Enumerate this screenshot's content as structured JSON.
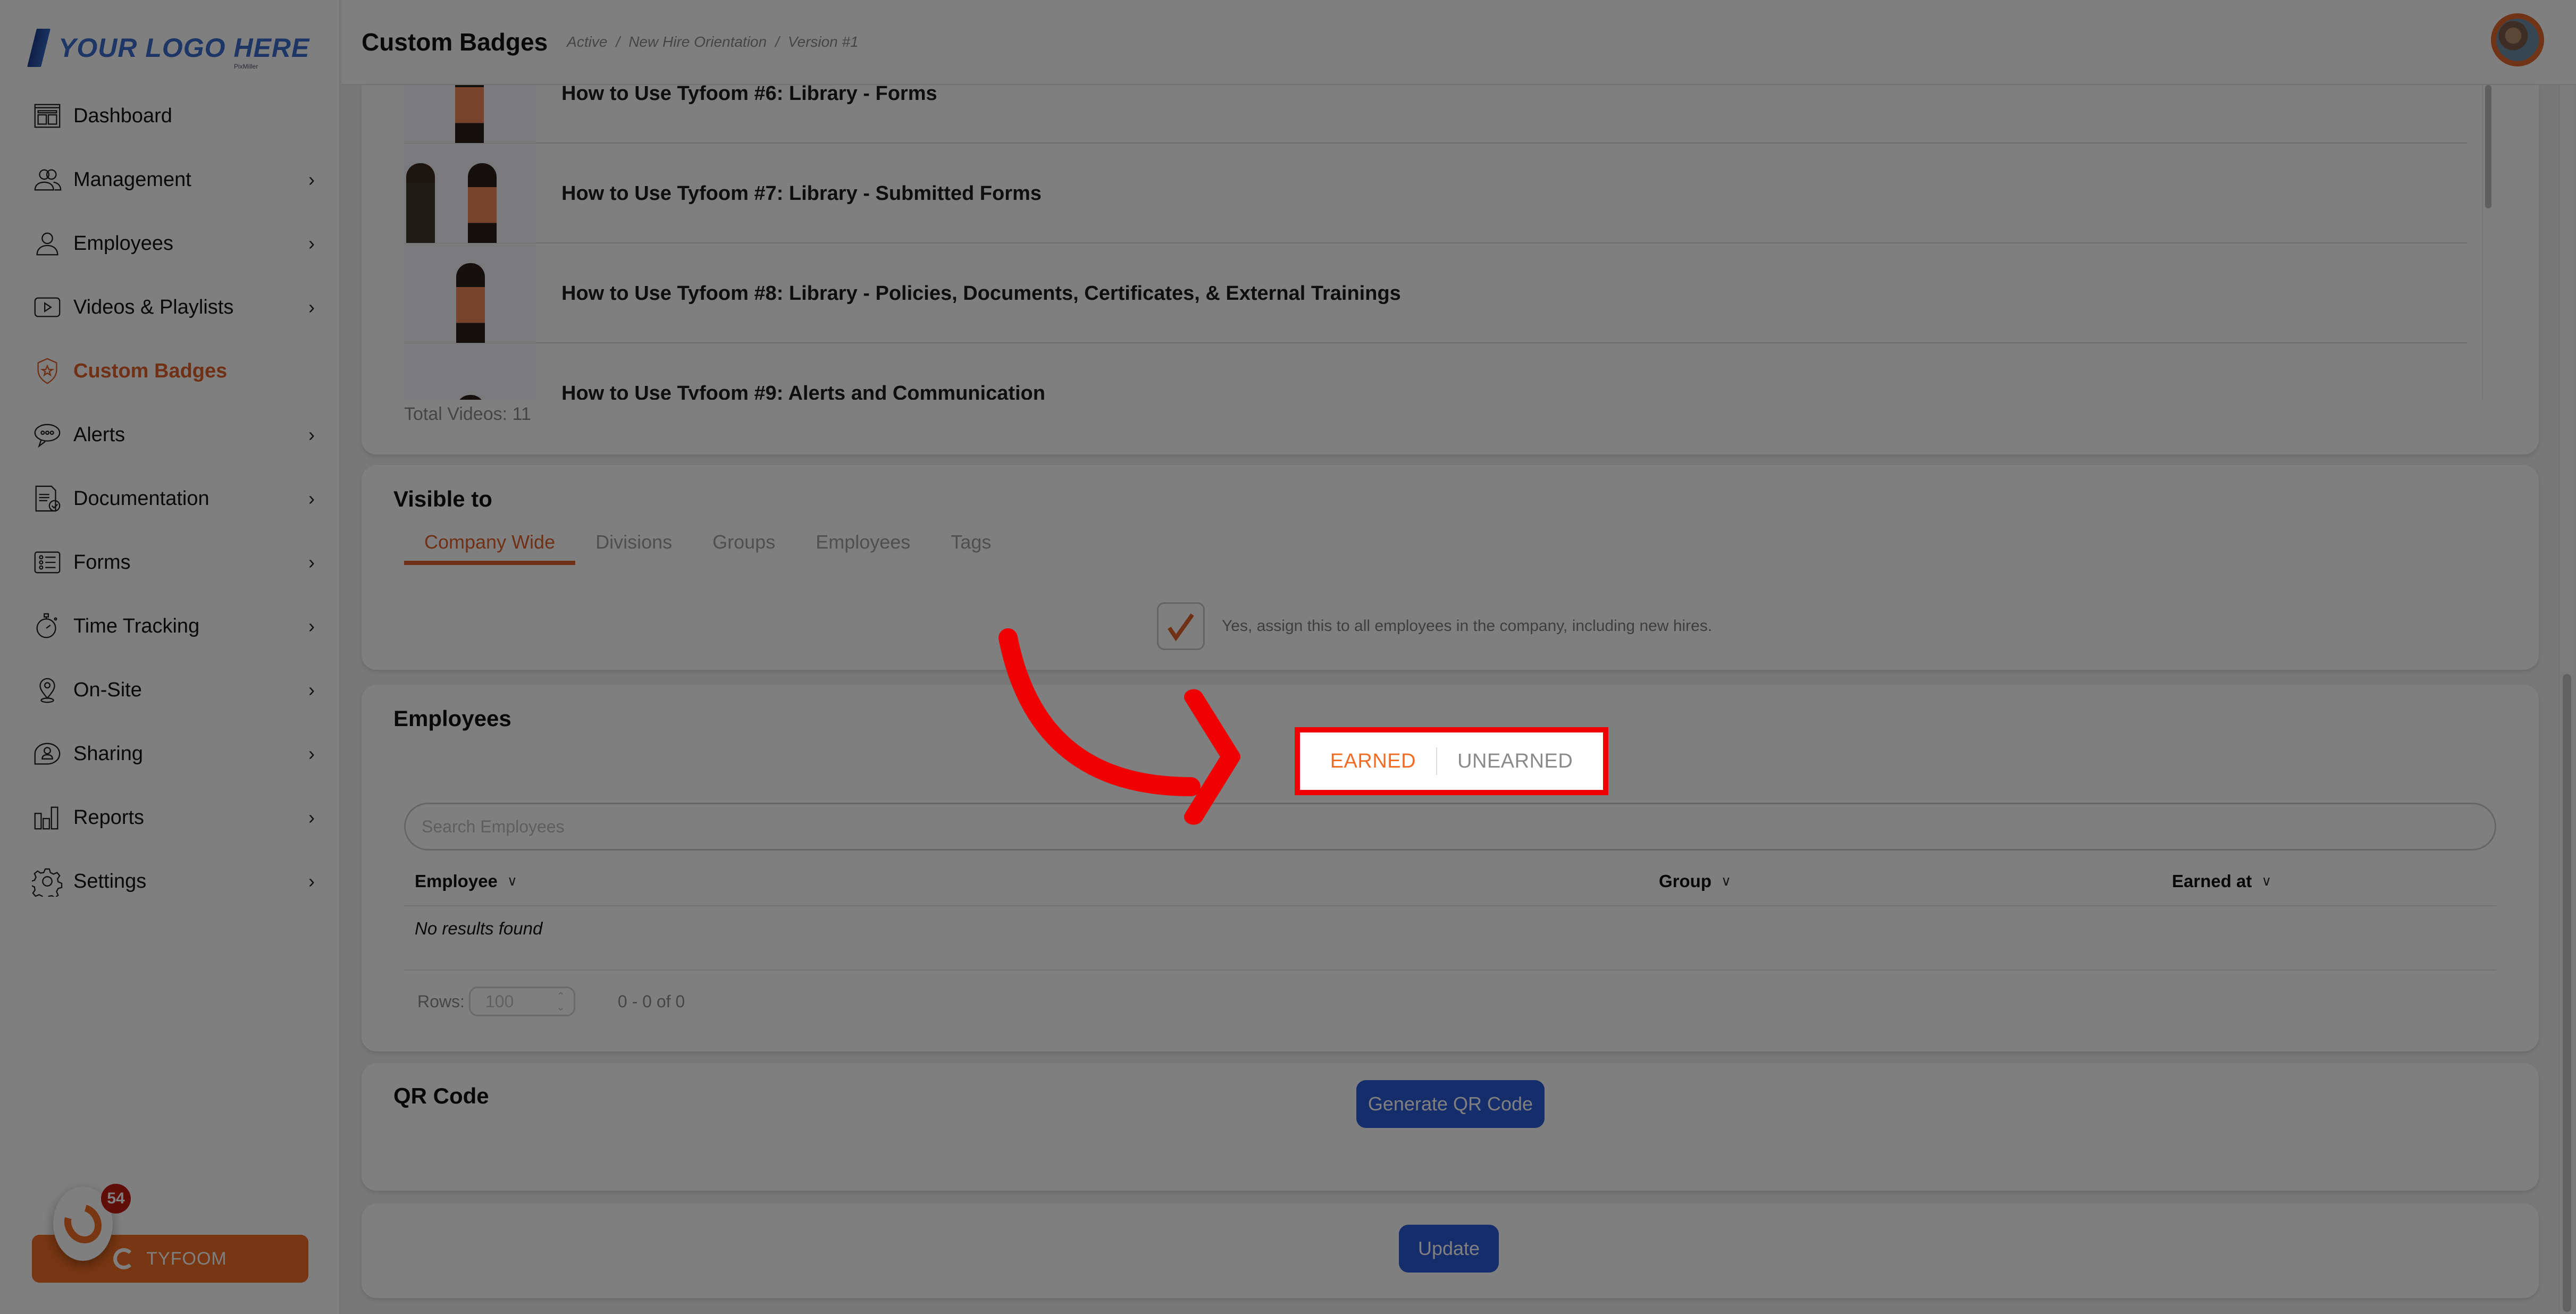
{
  "app": {
    "logo_text": "YOUR LOGO HERE",
    "logo_sub": "PixMiller"
  },
  "header": {
    "title": "Custom Badges",
    "breadcrumb": [
      "Active",
      "New Hire Orientation",
      "Version #1"
    ],
    "breadcrumb_sep": "/"
  },
  "sidebar": {
    "items": [
      {
        "label": "Dashboard",
        "icon": "dashboard-icon",
        "has_submenu": false,
        "active": false
      },
      {
        "label": "Management",
        "icon": "users-icon",
        "has_submenu": true,
        "active": false
      },
      {
        "label": "Employees",
        "icon": "user-icon",
        "has_submenu": true,
        "active": false
      },
      {
        "label": "Videos & Playlists",
        "icon": "play-icon",
        "has_submenu": true,
        "active": false
      },
      {
        "label": "Custom Badges",
        "icon": "shield-star-icon",
        "has_submenu": false,
        "active": true
      },
      {
        "label": "Alerts",
        "icon": "chat-bubble-icon",
        "has_submenu": true,
        "active": false
      },
      {
        "label": "Documentation",
        "icon": "document-check-icon",
        "has_submenu": true,
        "active": false
      },
      {
        "label": "Forms",
        "icon": "list-icon",
        "has_submenu": true,
        "active": false
      },
      {
        "label": "Time Tracking",
        "icon": "stopwatch-icon",
        "has_submenu": true,
        "active": false
      },
      {
        "label": "On-Site",
        "icon": "location-pin-icon",
        "has_submenu": true,
        "active": false
      },
      {
        "label": "Sharing",
        "icon": "share-user-icon",
        "has_submenu": true,
        "active": false
      },
      {
        "label": "Reports",
        "icon": "bar-chart-icon",
        "has_submenu": true,
        "active": false
      },
      {
        "label": "Settings",
        "icon": "gear-icon",
        "has_submenu": true,
        "active": false
      }
    ],
    "chevron": "›",
    "tyfoom_button": "TYFOOM",
    "chat_badge_count": "54"
  },
  "videos": {
    "items": [
      "How to Use Tyfoom #6: Library - Forms",
      "How to Use Tyfoom #7: Library - Submitted Forms",
      "How to Use Tyfoom #8: Library - Policies, Documents, Certificates, & External Trainings",
      "How to Use Tyfoom #9: Alerts and Communication"
    ],
    "total_label": "Total Videos: 11"
  },
  "visible_to": {
    "title": "Visible to",
    "tabs": [
      "Company Wide",
      "Divisions",
      "Groups",
      "Employees",
      "Tags"
    ],
    "active_tab": "Company Wide",
    "assign_checked": true,
    "assign_label": "Yes, assign this to all employees in the company, including new hires."
  },
  "employees": {
    "title": "Employees",
    "toggle": {
      "earned": "EARNED",
      "unearned": "UNEARNED",
      "selected": "EARNED"
    },
    "search_placeholder": "Search Employees",
    "search_value": "",
    "columns": [
      "Employee",
      "Group",
      "Earned at"
    ],
    "empty_text": "No results found",
    "rows_label": "Rows:",
    "rows_value": "100",
    "range_text": "0 - 0 of 0"
  },
  "qr": {
    "title": "QR Code",
    "generate_label": "Generate QR Code"
  },
  "footer": {
    "update_label": "Update"
  },
  "colors": {
    "accent": "#e0612a",
    "primary_button": "#2a5bd7",
    "highlight": "#f00000"
  }
}
